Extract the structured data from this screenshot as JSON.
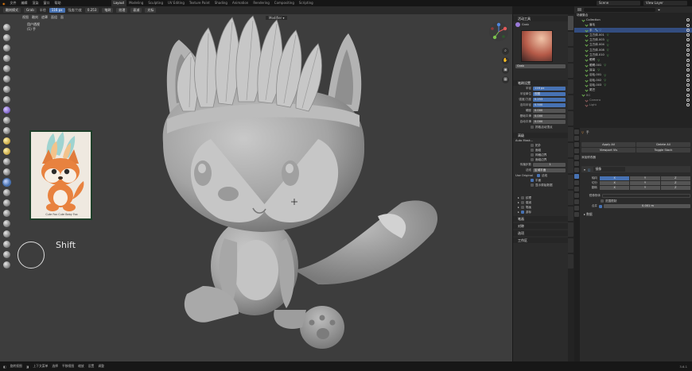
{
  "topbar": {
    "menus": [
      "文件",
      "编辑",
      "渲染",
      "窗口",
      "帮助"
    ],
    "workspaces": [
      "Layout",
      "Modeling",
      "Sculpting",
      "UV Editing",
      "Texture Paint",
      "Shading",
      "Animation",
      "Rendering",
      "Compositing",
      "Scripting"
    ],
    "active_workspace": "Layout",
    "scene": "Scene",
    "view_layer": "View Layer"
  },
  "tool_header": {
    "mode": "雕刻模式",
    "brush": "Grab",
    "radius_label": "半径",
    "radius_value": "116 px",
    "strength_label": "强度/力度",
    "strength_value": "0.253",
    "items": [
      "笔刷",
      "纹理",
      "衰减",
      "光标"
    ]
  },
  "viewport": {
    "header_items": [
      "视图",
      "雕刻",
      "遮罩",
      "面组",
      "面"
    ],
    "mode_label": "用户透视",
    "object_label": "(1) 手",
    "search_label": "Modifier ▾",
    "shift_label": "Shift",
    "ref_caption": "Cute Fox Cute Baby Fox"
  },
  "npanel": {
    "tool_title": "活动工具",
    "brush_name": "Grab",
    "brush_label": "Grab",
    "brush_settings_title": "笔刷设置",
    "fields": [
      {
        "label": "半径",
        "value": "116 px"
      },
      {
        "label": "半径单位",
        "value": "视图"
      },
      {
        "label": "强度/力度",
        "value": "0.253"
      },
      {
        "label": "法向半径",
        "value": "0.500"
      },
      {
        "label": "硬度",
        "value": "0.000"
      },
      {
        "label": "基础平滑",
        "value": "0.000"
      },
      {
        "label": "自动平滑",
        "value": "0.000"
      }
    ],
    "grab_active_vertex": "抓取活动顶点",
    "advanced_title": "高级",
    "automasking": "Auto Mask...",
    "auto_items": [
      "拓扑",
      "面组",
      "网格边界",
      "面组边界"
    ],
    "propagation_label": "传播步数",
    "propagation_value": "1",
    "normal_label": "法线",
    "normal_value": "区域平面",
    "original_label": "Use Original",
    "original_items": [
      "法线",
      "平面"
    ],
    "show_original": "显示原始数据",
    "subsections": [
      "纹理",
      "衰减",
      "笔画",
      "游标"
    ],
    "bottom_sections": [
      "笔画",
      "对称",
      "选项",
      "工作区",
      "动态拓扑",
      "重构网格"
    ]
  },
  "outliner": {
    "title": "场景集合",
    "rows": [
      {
        "name": "Collection",
        "sel": false,
        "extra": ""
      },
      {
        "name": "眉毛",
        "sel": false,
        "extra": ""
      },
      {
        "name": "手",
        "sel": true,
        "extra": "🔧 ▽"
      },
      {
        "name": "立方体.001",
        "sel": false,
        "extra": "▽"
      },
      {
        "name": "立方体.003",
        "sel": false,
        "extra": "▽"
      },
      {
        "name": "立方体.004",
        "sel": false,
        "extra": "▽"
      },
      {
        "name": "立方体.008",
        "sel": false,
        "extra": "▽"
      },
      {
        "name": "立方体.010",
        "sel": false,
        "extra": "▽"
      },
      {
        "name": "眼睛",
        "sel": false,
        "extra": "▽"
      },
      {
        "name": "眼睛.001",
        "sel": false,
        "extra": "▽"
      },
      {
        "name": "耳朵",
        "sel": false,
        "extra": "▽"
      },
      {
        "name": "羽毛.001",
        "sel": false,
        "extra": "▽"
      },
      {
        "name": "羽毛.002",
        "sel": false,
        "extra": "▽"
      },
      {
        "name": "羽毛.003",
        "sel": false,
        "extra": "▽"
      },
      {
        "name": "尾巴",
        "sel": false,
        "extra": ""
      },
      {
        "name": "BG",
        "sel": false,
        "extra": ""
      },
      {
        "name": "Camera",
        "sel": false,
        "extra": ""
      },
      {
        "name": "Light",
        "sel": false,
        "extra": ""
      }
    ]
  },
  "properties": {
    "object_name": "手",
    "buttons": [
      "Apply All",
      "Delete All",
      "Viewport Vis",
      "Toggle Stack"
    ],
    "add_modifier": "添加修改器",
    "modifier_name": "镜像",
    "axis_label": "轴向",
    "bisect_label": "切分",
    "flip_label": "翻转",
    "axes": [
      "X",
      "Y",
      "Z"
    ],
    "mirror_object": "镜像物体",
    "clipping": "范围限制",
    "merge": "合并",
    "merge_value": "0.001 m",
    "data_section": "数据"
  },
  "statusbar": {
    "items": [
      "旋转视图",
      "上下文菜单",
      "选择",
      "平移视图",
      "缩放",
      "设置",
      "调整"
    ],
    "version": "3.6.1"
  }
}
